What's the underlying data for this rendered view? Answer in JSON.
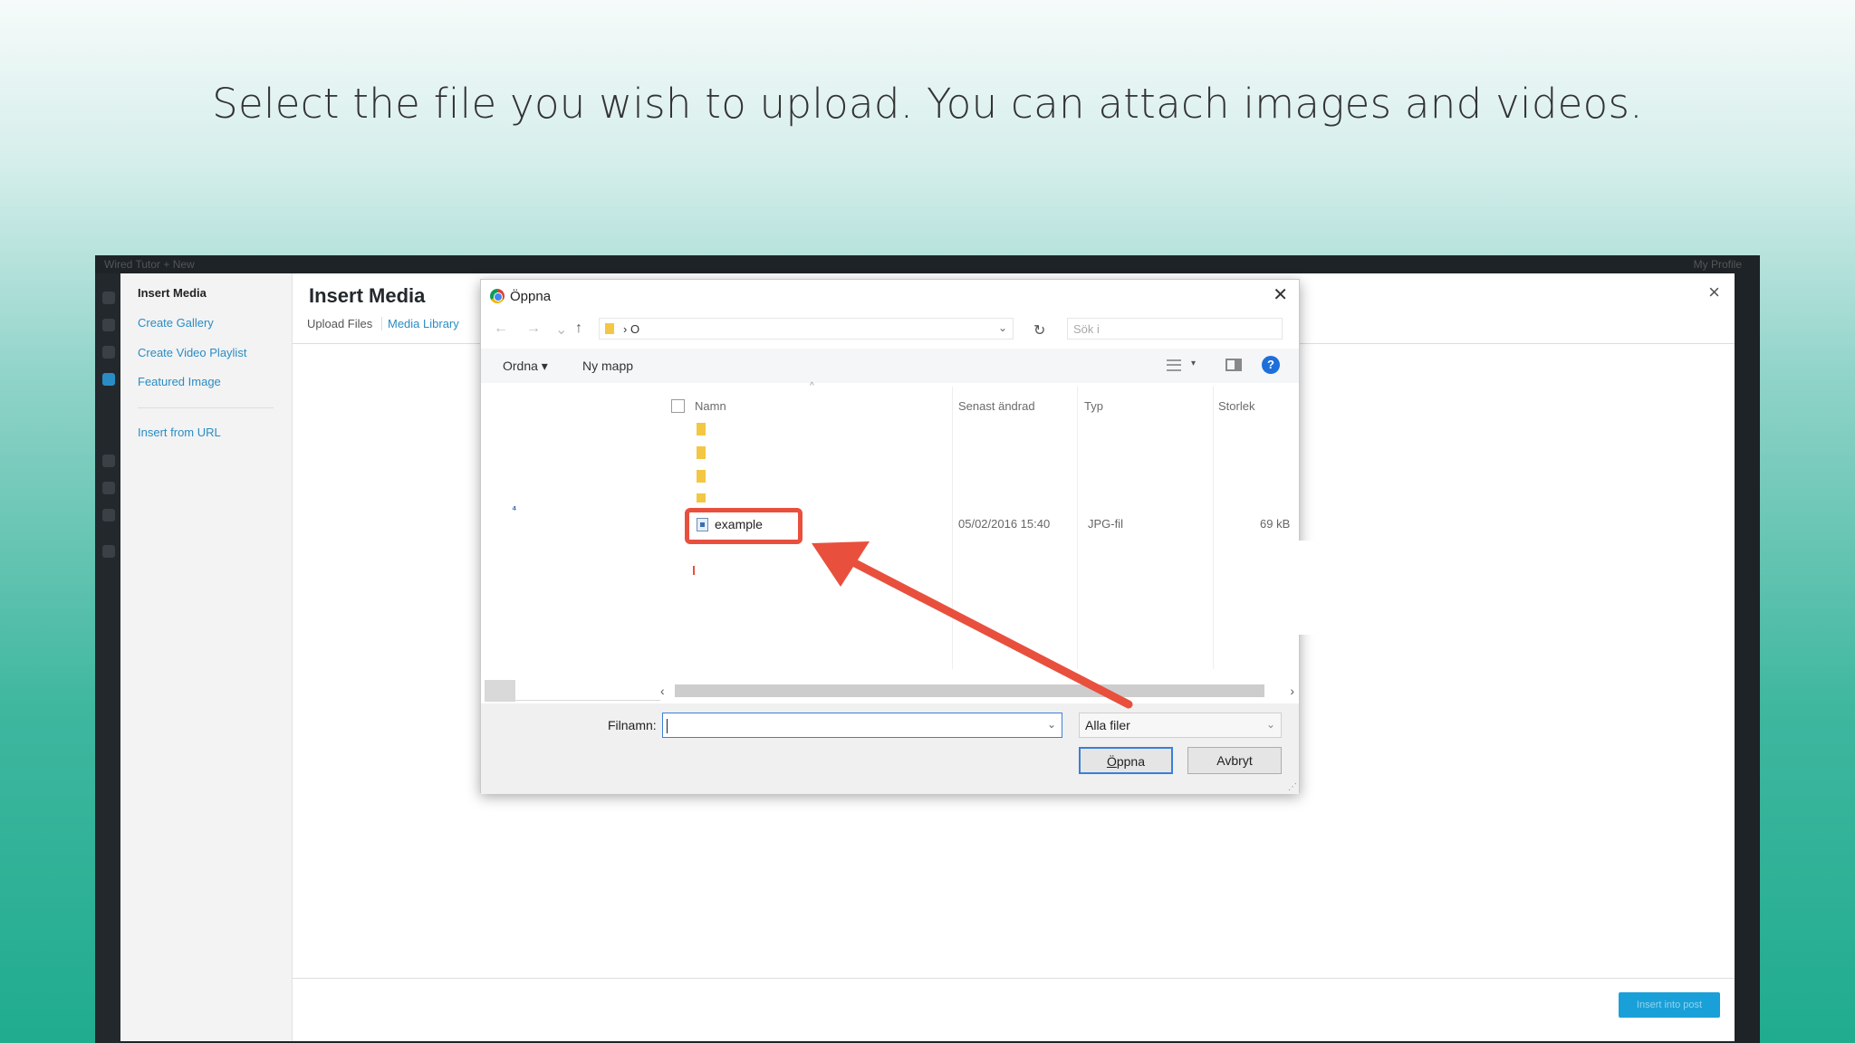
{
  "caption": "Select the file you wish to upload. You can attach images and videos.",
  "wp": {
    "admin_bar_left": "Wired Tutor   + New",
    "admin_bar_right": "My Profile",
    "menu": {
      "insert_media": "Insert Media",
      "create_gallery": "Create Gallery",
      "create_video_playlist": "Create Video Playlist",
      "featured_image": "Featured Image",
      "insert_from_url": "Insert from URL"
    },
    "title": "Insert Media",
    "tabs": {
      "upload_files": "Upload Files",
      "media_library": "Media Library"
    },
    "close": "×",
    "insert_button": "Insert into post"
  },
  "dialog": {
    "title": "Öppna",
    "close": "✕",
    "nav": {
      "back": "←",
      "forward": "→",
      "recent": "⌄",
      "up": "↑"
    },
    "address": {
      "path": "› O",
      "dropdown": "⌄"
    },
    "refresh": "↻",
    "search_placeholder": "Sök i",
    "toolbar": {
      "organize": "Ordna ▾",
      "new_folder": "Ny mapp",
      "view_dropdown": "▾",
      "help": "?"
    },
    "columns": {
      "name": "Namn",
      "modified": "Senast ändrad",
      "type": "Typ",
      "size": "Storlek"
    },
    "nav_marker": "⁴",
    "file": {
      "name": "example",
      "modified": "05/02/2016 15:40",
      "type": "JPG-fil",
      "size": "69 kB"
    },
    "scroll": {
      "left": "‹",
      "right": "›"
    },
    "filename_label": "Filnamn:",
    "filename_value": "",
    "filter": "Alla filer",
    "dropdown": "⌄",
    "open_label_u": "Ö",
    "open_label_rest": "ppna",
    "cancel_label": "Avbryt",
    "grip": "⋰"
  },
  "colors": {
    "highlight": "#e8503d",
    "accent": "#2a8cc4",
    "dialog_focus": "#3b7fd6"
  }
}
